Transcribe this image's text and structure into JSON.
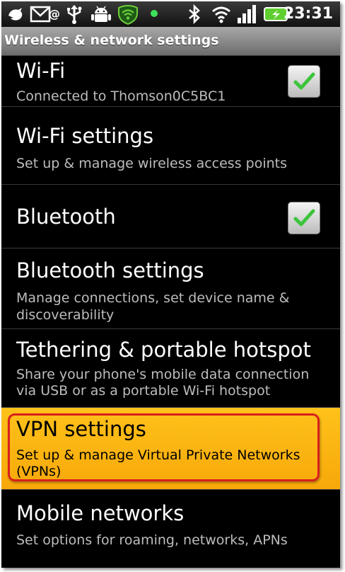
{
  "status_bar": {
    "time": "23:31",
    "icons": [
      "twitter-bird-icon",
      "email-icon",
      "usb-icon",
      "android-debug-icon",
      "wifi-shield-icon",
      "notification-led-icon",
      "bluetooth-icon",
      "wifi-signal-icon",
      "cell-signal-icon",
      "battery-charging-icon"
    ],
    "accent_color": "#6fcf3a"
  },
  "screen_title": "Wireless & network settings",
  "settings": [
    {
      "title": "Wi-Fi",
      "summary": "Connected to Thomson0C5BC1",
      "checked": true
    },
    {
      "title": "Wi-Fi settings",
      "summary": "Set up & manage wireless access points"
    },
    {
      "title": "Bluetooth",
      "checked": true
    },
    {
      "title": "Bluetooth settings",
      "summary_line1": "Manage connections, set device name &",
      "summary_line2": "discoverability"
    },
    {
      "title": "Tethering & portable hotspot",
      "summary_line1": "Share your phone's mobile data connection",
      "summary_line2": "via USB or as a portable Wi-Fi hotspot"
    },
    {
      "title": "VPN settings",
      "summary_line1": "Set up & manage Virtual Private Networks",
      "summary_line2": "(VPNs)",
      "highlighted": true
    },
    {
      "title": "Mobile networks",
      "summary": "Set options for roaming, networks, APNs"
    }
  ],
  "colors": {
    "highlight": "#ffb812",
    "annotation_border": "#d8201c",
    "check_green": "#3cc43c"
  }
}
